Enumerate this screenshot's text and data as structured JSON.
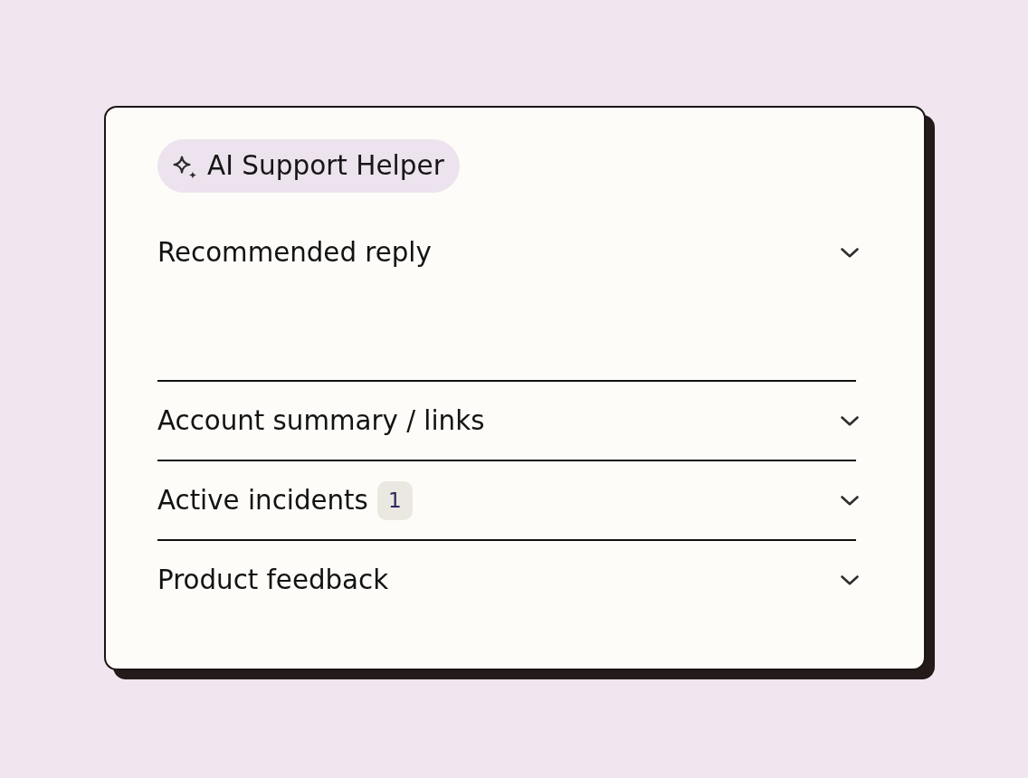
{
  "assistant": {
    "title": "AI Support Helper"
  },
  "sections": [
    {
      "title": "Recommended reply"
    },
    {
      "title": "Account summary / links"
    },
    {
      "title": "Active incidents",
      "count": "1"
    },
    {
      "title": "Product feedback"
    }
  ]
}
